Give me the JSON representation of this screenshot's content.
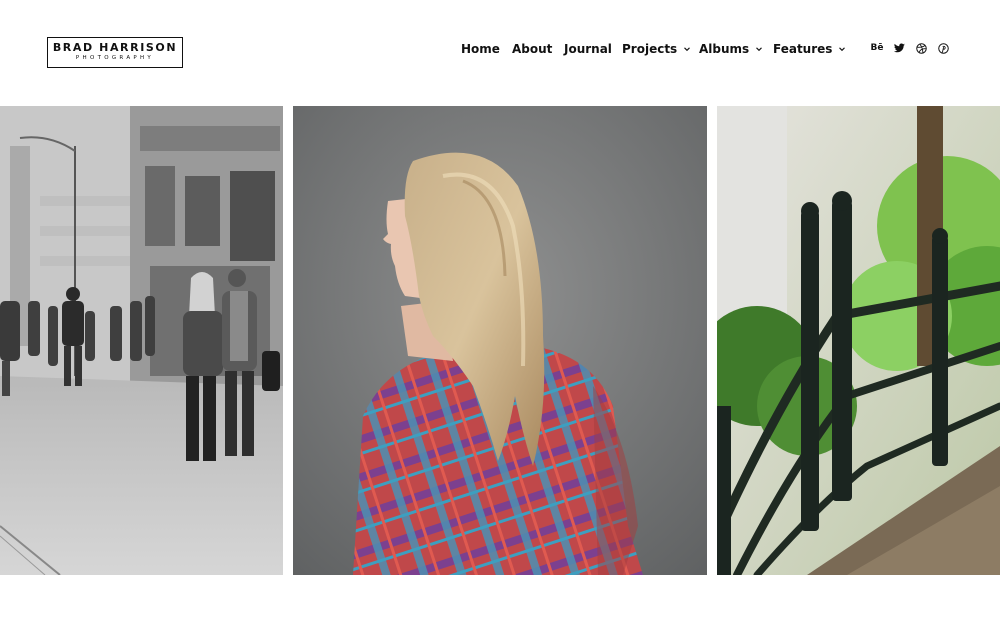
{
  "logo": {
    "name": "BRAD HARRISON",
    "subtitle": "PHOTOGRAPHY"
  },
  "nav": {
    "items": [
      {
        "label": "Home",
        "has_dropdown": false
      },
      {
        "label": "About",
        "has_dropdown": false
      },
      {
        "label": "Journal",
        "has_dropdown": false
      },
      {
        "label": "Projects",
        "has_dropdown": true
      },
      {
        "label": "Albums",
        "has_dropdown": true
      },
      {
        "label": "Features",
        "has_dropdown": true
      }
    ]
  },
  "social": {
    "behance_label": "Bē",
    "icons": [
      "behance-icon",
      "twitter-icon",
      "dribbble-icon",
      "pinterest-icon"
    ]
  },
  "gallery": {
    "photos": [
      {
        "subject": "street-scene-black-and-white"
      },
      {
        "subject": "woman-profile-plaid-shirt"
      },
      {
        "subject": "green-railing-footbridge"
      }
    ]
  },
  "colors": {
    "text": "#111111",
    "background": "#ffffff"
  }
}
